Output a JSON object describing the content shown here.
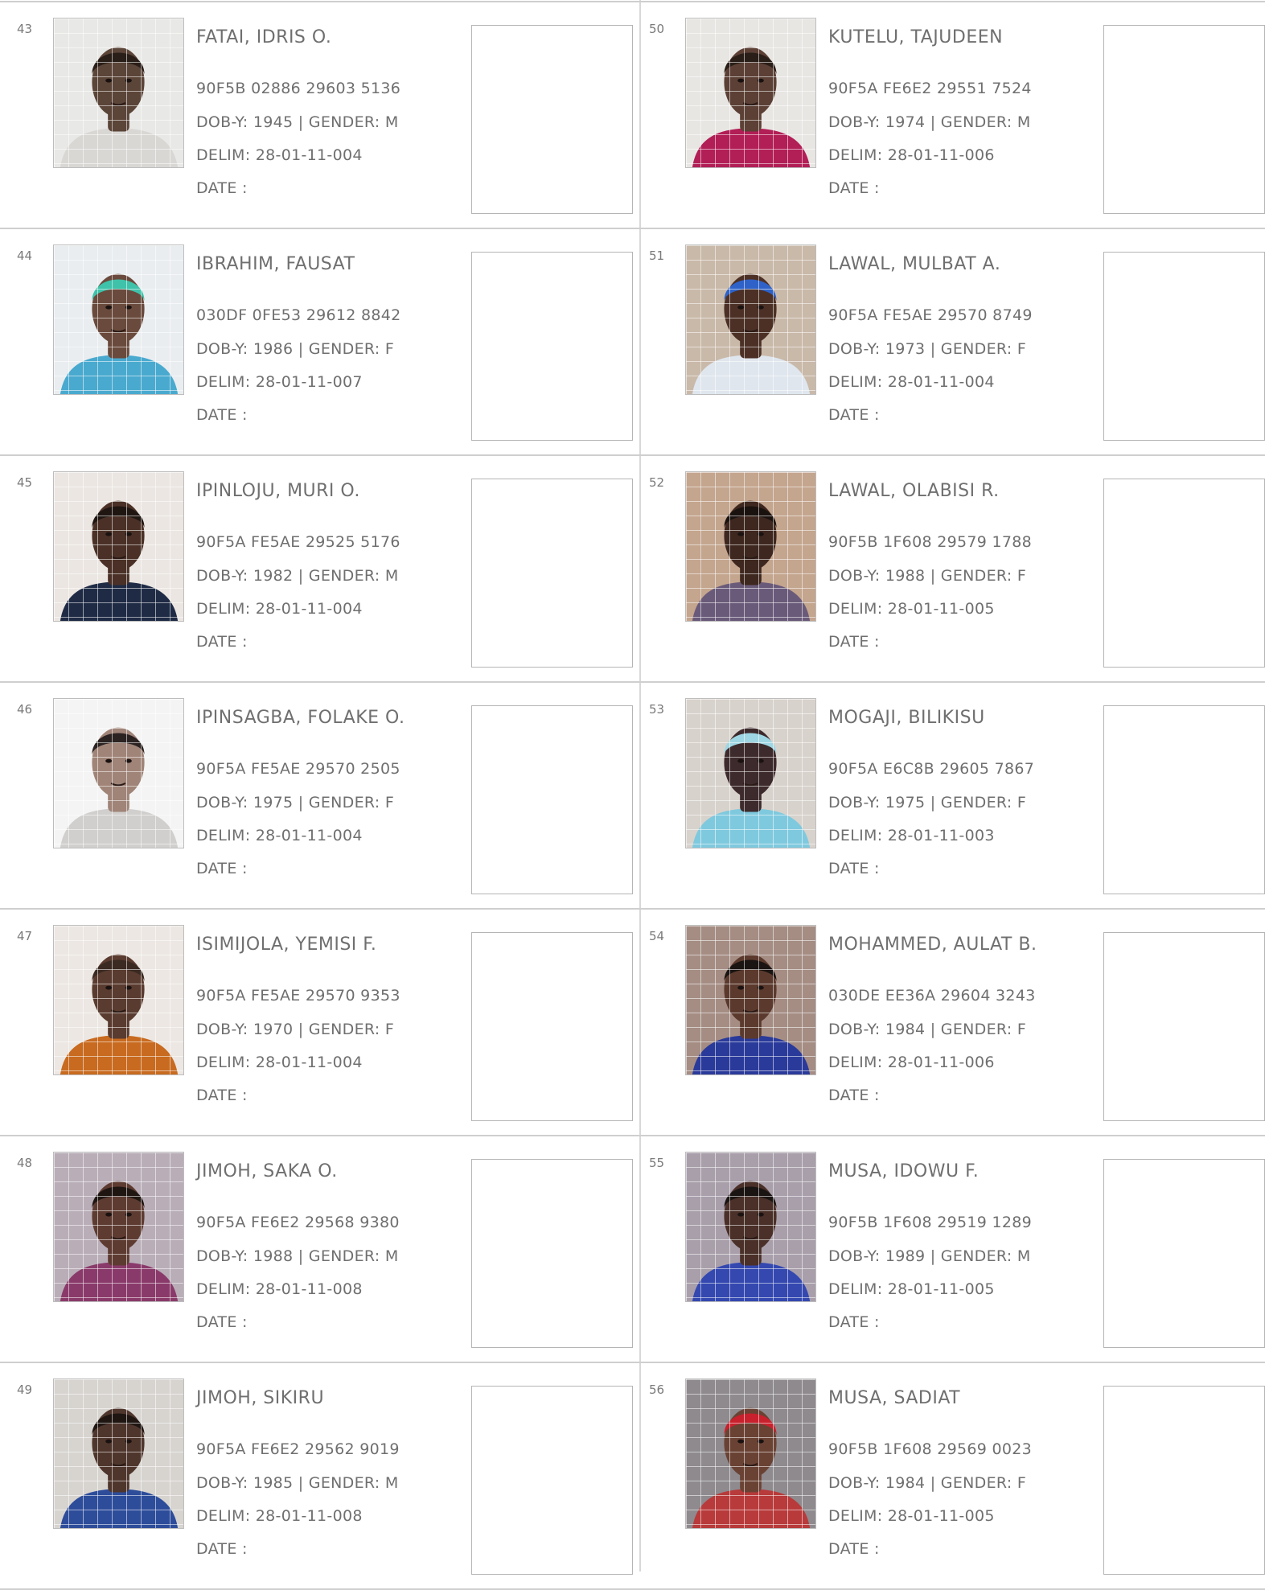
{
  "labels": {
    "dob": "DOB-Y:",
    "gender_sep": "| GENDER:",
    "delim": "DELIM:",
    "date": "DATE :"
  },
  "columns": [
    [
      {
        "num": "43",
        "name": "FATAI, IDRIS O.",
        "code": "90F5B 02886 29603 5136",
        "dob": "1945",
        "gender": "M",
        "delim": "28-01-11-004",
        "photo": {
          "bg": "#e8e8e6",
          "skin": "#5b4438",
          "cloth": "#d9d7d4",
          "hair": "#2a1e18"
        }
      },
      {
        "num": "44",
        "name": "IBRAHIM, FAUSAT",
        "code": "030DF 0FE53 29612 8842",
        "dob": "1986",
        "gender": "F",
        "delim": "28-01-11-007",
        "photo": {
          "bg": "#e9edf0",
          "skin": "#6a4a3c",
          "cloth": "#49a9cf",
          "hair": "#3ec2a9"
        }
      },
      {
        "num": "45",
        "name": "IPINLOJU, MURI O.",
        "code": "90F5A FE5AE 29525 5176",
        "dob": "1982",
        "gender": "M",
        "delim": "28-01-11-004",
        "photo": {
          "bg": "#ebe6e2",
          "skin": "#4a3026",
          "cloth": "#1f2b45",
          "hair": "#1f1612"
        }
      },
      {
        "num": "46",
        "name": "IPINSAGBA, FOLAKE O.",
        "code": "90F5A FE5AE 29570 2505",
        "dob": "1975",
        "gender": "F",
        "delim": "28-01-11-004",
        "photo": {
          "bg": "#f4f4f4",
          "skin": "#a08478",
          "cloth": "#d0cfcd",
          "hair": "#2b2322"
        }
      },
      {
        "num": "47",
        "name": "ISIMIJOLA, YEMISI F.",
        "code": "90F5A FE5AE 29570 9353",
        "dob": "1970",
        "gender": "F",
        "delim": "28-01-11-004",
        "photo": {
          "bg": "#ece7e2",
          "skin": "#5a3b2f",
          "cloth": "#c86a1f",
          "hair": "#3a2a22"
        }
      },
      {
        "num": "48",
        "name": "JIMOH, SAKA O.",
        "code": "90F5A FE6E2 29568 9380",
        "dob": "1988",
        "gender": "M",
        "delim": "28-01-11-008",
        "photo": {
          "bg": "#b9aeb8",
          "skin": "#5e3b31",
          "cloth": "#8a3a6a",
          "hair": "#1f1612"
        }
      },
      {
        "num": "49",
        "name": "JIMOH, SIKIRU",
        "code": "90F5A FE6E2 29562 9019",
        "dob": "1985",
        "gender": "M",
        "delim": "28-01-11-008",
        "photo": {
          "bg": "#d7d4d0",
          "skin": "#4f362c",
          "cloth": "#2d4c9a",
          "hair": "#1f1612"
        }
      }
    ],
    [
      {
        "num": "50",
        "name": "KUTELU, TAJUDEEN",
        "code": "90F5A FE6E2 29551 7524",
        "dob": "1974",
        "gender": "M",
        "delim": "28-01-11-006",
        "photo": {
          "bg": "#e8e6e3",
          "skin": "#5c4035",
          "cloth": "#b21e56",
          "hair": "#2a1e18"
        }
      },
      {
        "num": "51",
        "name": "LAWAL, MULBAT A.",
        "code": "90F5A FE5AE 29570 8749",
        "dob": "1973",
        "gender": "F",
        "delim": "28-01-11-004",
        "photo": {
          "bg": "#c9b9a9",
          "skin": "#4c3026",
          "cloth": "#dfe6ee",
          "hair": "#2e62c8"
        }
      },
      {
        "num": "52",
        "name": "LAWAL, OLABISI R.",
        "code": "90F5B 1F608 29579 1788",
        "dob": "1988",
        "gender": "F",
        "delim": "28-01-11-005",
        "photo": {
          "bg": "#c4a58e",
          "skin": "#3e271f",
          "cloth": "#6a5a7a",
          "hair": "#1a120f"
        }
      },
      {
        "num": "53",
        "name": "MOGAJI, BILIKISU",
        "code": "90F5A E6C8B 29605 7867",
        "dob": "1975",
        "gender": "F",
        "delim": "28-01-11-003",
        "photo": {
          "bg": "#d8d2cc",
          "skin": "#3d2a2c",
          "cloth": "#7fc9de",
          "hair": "#9fd6e3"
        }
      },
      {
        "num": "54",
        "name": "MOHAMMED, AULAT B.",
        "code": "030DE EE36A 29604 3243",
        "dob": "1984",
        "gender": "F",
        "delim": "28-01-11-006",
        "photo": {
          "bg": "#a58d84",
          "skin": "#5b3a2d",
          "cloth": "#2a3a9a",
          "hair": "#1a1412"
        }
      },
      {
        "num": "55",
        "name": "MUSA, IDOWU F.",
        "code": "90F5B 1F608 29519 1289",
        "dob": "1989",
        "gender": "M",
        "delim": "28-01-11-005",
        "photo": {
          "bg": "#a99fab",
          "skin": "#4a3028",
          "cloth": "#3448b0",
          "hair": "#1a1412"
        }
      },
      {
        "num": "56",
        "name": "MUSA, SADIAT",
        "code": "90F5B 1F608 29569 0023",
        "dob": "1984",
        "gender": "F",
        "delim": "28-01-11-005",
        "photo": {
          "bg": "#8e8a8e",
          "skin": "#6a4234",
          "cloth": "#b83a3a",
          "hair": "#c8202c"
        }
      }
    ]
  ]
}
